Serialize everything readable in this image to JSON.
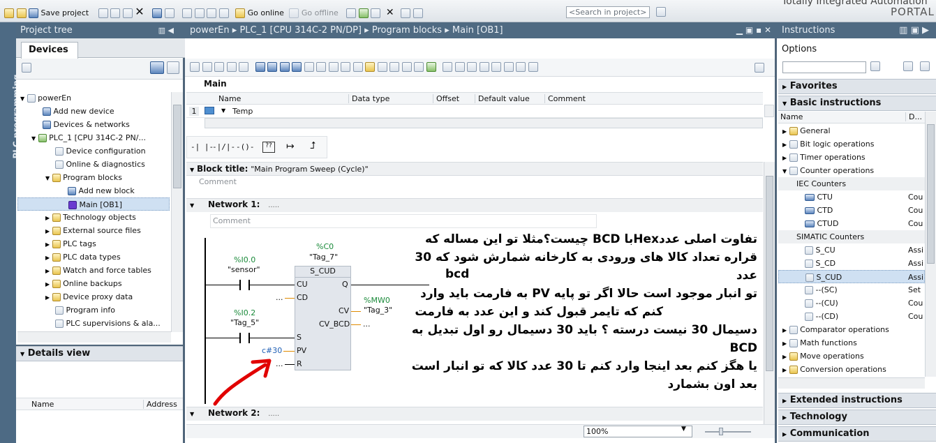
{
  "toolbar": {
    "save_project": "Save project",
    "go_online": "Go online",
    "go_offline": "Go offline",
    "search_placeholder": "<Search in project>",
    "brand_line1": "Totally Integrated Automation",
    "brand_line2": "PORTAL"
  },
  "side_tab": {
    "label": "PLC programming"
  },
  "project_tree": {
    "title": "Project tree",
    "tab": "Devices",
    "items": [
      {
        "label": "powerEn"
      },
      {
        "label": "Add new device"
      },
      {
        "label": "Devices & networks"
      },
      {
        "label": "PLC_1 [CPU 314C-2 PN/..."
      },
      {
        "label": "Device configuration"
      },
      {
        "label": "Online & diagnostics"
      },
      {
        "label": "Program blocks"
      },
      {
        "label": "Add new block"
      },
      {
        "label": "Main [OB1]"
      },
      {
        "label": "Technology objects"
      },
      {
        "label": "External source files"
      },
      {
        "label": "PLC tags"
      },
      {
        "label": "PLC data types"
      },
      {
        "label": "Watch and force tables"
      },
      {
        "label": "Online backups"
      },
      {
        "label": "Device proxy data"
      },
      {
        "label": "Program info"
      },
      {
        "label": "PLC supervisions & ala..."
      }
    ]
  },
  "details_view": {
    "title": "Details view",
    "col_name": "Name",
    "col_address": "Address"
  },
  "editor": {
    "breadcrumb": [
      "powerEn",
      "PLC_1 [CPU 314C-2 PN/DP]",
      "Program blocks",
      "Main [OB1]"
    ],
    "block_name": "Main",
    "iface_headers": [
      "Name",
      "Data type",
      "Offset",
      "Default value",
      "Comment"
    ],
    "iface_row_num": "1",
    "iface_row_name": "Temp",
    "block_title_label": "Block title:",
    "block_title_value": "\"Main Program Sweep (Cycle)\"",
    "comment": "Comment",
    "network1": "Network 1:",
    "network1_dots": ".....",
    "network2": "Network 2:",
    "network2_dots": ".....",
    "zoom": "100%"
  },
  "ladder": {
    "counter_addr": "%C0",
    "counter_tag": "\"Tag_7\"",
    "counter_type": "S_CUD",
    "in_cu": "CU",
    "in_cd": "CD",
    "in_s": "S",
    "in_pv": "PV",
    "in_r": "R",
    "out_q": "Q",
    "out_cv": "CV",
    "out_cvbcd": "CV_BCD",
    "contact1_addr": "%I0.0",
    "contact1_tag": "\"sensor\"",
    "contact2_addr": "%I0.2",
    "contact2_tag": "\"Tag_5\"",
    "cv_addr": "%MW0",
    "cv_tag": "\"Tag_3\"",
    "pv_value": "c#30",
    "dots": "...",
    "bcd_label": "bcd"
  },
  "annotation": {
    "lines": [
      "تفاوت اصلی عددHexبا BCD چیست؟مثلا تو این مساله که",
      "قراره تعداد کالا های ورودی به کارخانه شمارش شود که 30 عدد",
      "تو انبار موجود است حالا اگر تو پایه PV به فارمت  باید وارد",
      "کنم که تایمر قبول کند و این عدد به فارمت",
      "دسیمال 30 نیست درسته ؟ باید 30 دسیمال رو اول تبدیل به BCD",
      "یا هگز کنم بعد اینجا وارد کنم تا 30 عدد کالا که تو انبار است",
      "بعد اون بشمارد"
    ]
  },
  "instructions": {
    "title": "Instructions",
    "options": "Options",
    "favorites": "Favorites",
    "basic": "Basic instructions",
    "col_name": "Name",
    "col_desc": "D...",
    "items": [
      {
        "label": "General",
        "desc": ""
      },
      {
        "label": "Bit logic operations",
        "desc": ""
      },
      {
        "label": "Timer operations",
        "desc": ""
      },
      {
        "label": "Counter operations",
        "desc": ""
      },
      {
        "label": "IEC Counters",
        "desc": ""
      },
      {
        "label": "CTU",
        "desc": "Cou"
      },
      {
        "label": "CTD",
        "desc": "Cou"
      },
      {
        "label": "CTUD",
        "desc": "Cou"
      },
      {
        "label": "SIMATIC Counters",
        "desc": ""
      },
      {
        "label": "S_CU",
        "desc": "Assi"
      },
      {
        "label": "S_CD",
        "desc": "Assi"
      },
      {
        "label": "S_CUD",
        "desc": "Assi"
      },
      {
        "label": "--(SC)",
        "desc": "Set"
      },
      {
        "label": "--(CU)",
        "desc": "Cou"
      },
      {
        "label": "--(CD)",
        "desc": "Cou"
      },
      {
        "label": "Comparator operations",
        "desc": ""
      },
      {
        "label": "Math functions",
        "desc": ""
      },
      {
        "label": "Move operations",
        "desc": ""
      },
      {
        "label": "Conversion operations",
        "desc": ""
      }
    ],
    "extended": "Extended instructions",
    "technology": "Technology",
    "communication": "Communication"
  }
}
